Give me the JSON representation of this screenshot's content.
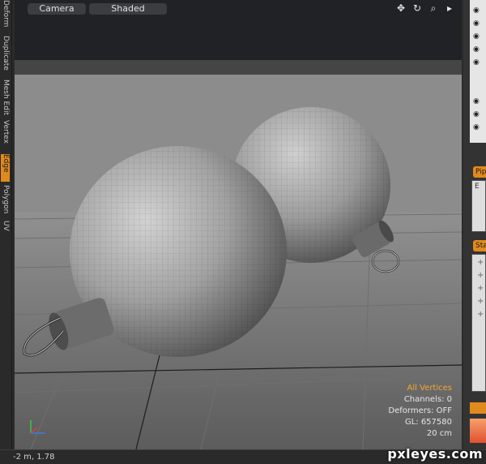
{
  "viewport": {
    "tabs": [
      "Camera",
      "Shaded"
    ],
    "tool_icons": [
      "move-icon",
      "rotate-icon",
      "zoom-icon",
      "play-icon"
    ],
    "stats": {
      "selection_mode": "All Vertices",
      "channels": "Channels: 0",
      "deformers": "Deformers: OFF",
      "gl": "GL: 657580",
      "grid_size": "20 cm"
    }
  },
  "left_tabs": [
    "Deform",
    "Duplicate",
    "Mesh Edit",
    "Vertex",
    "Edge",
    "Polygon",
    "UV"
  ],
  "right_panel": {
    "tab1": "Pip",
    "tab2": "Sta",
    "box_label": "E"
  },
  "statusbar": {
    "coords": "-2 m, 1.78"
  },
  "watermark": "pxleyes.com",
  "colors": {
    "accent": "#e08a1e",
    "highlight": "#f0a830"
  }
}
